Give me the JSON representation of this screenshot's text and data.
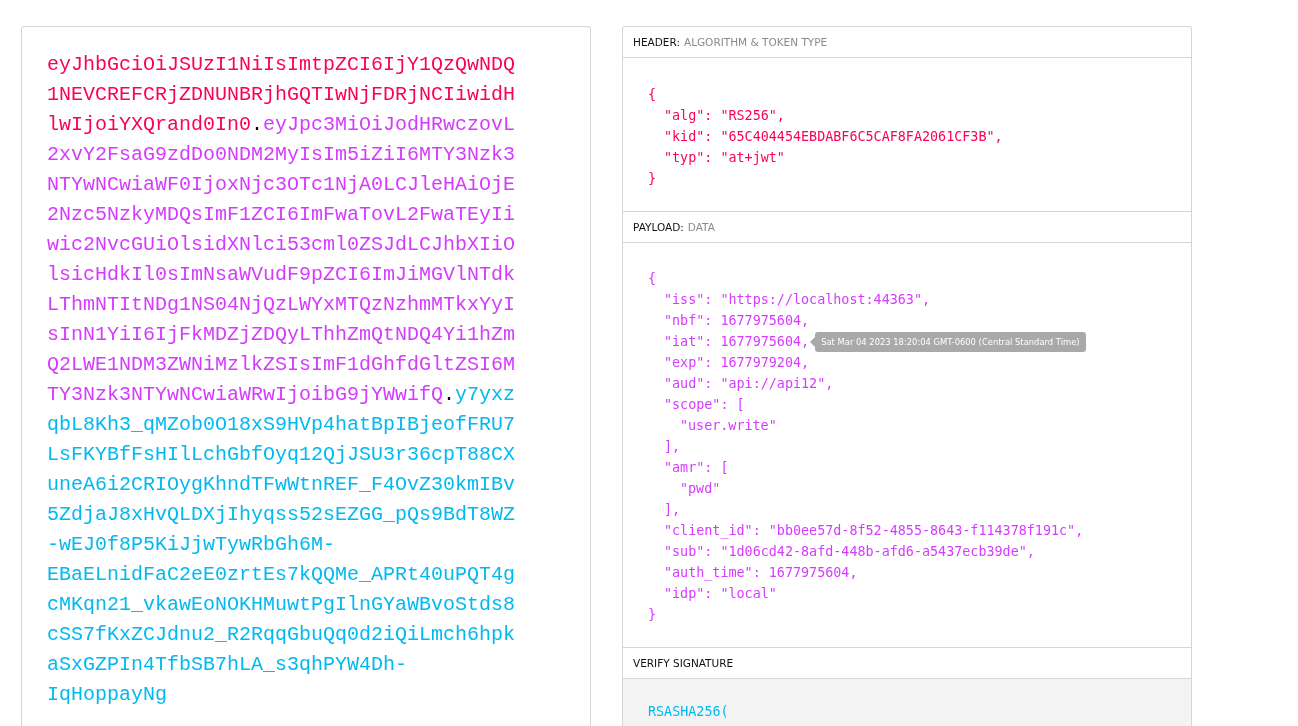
{
  "encoded_token": {
    "parts": [
      {
        "kind": "header",
        "text": "eyJhbGciOiJSUzI1NiIsImtpZCI6IjY1QzQwNDQ1NEVCREFCRjZDNUNBRjhGQTIwNjFDRjNCIiwidHlwIjoiYXQrand0In0"
      },
      {
        "kind": "dot",
        "text": "."
      },
      {
        "kind": "payload",
        "text": "eyJpc3MiOiJodHRwczovL2xvY2FsaG9zdDo0NDM2MyIsIm5iZiI6MTY3Nzk3NTYwNCwiaWF0IjoxNjc3OTc1NjA0LCJleHAiOjE2Nzc5NzkyMDQsImF1ZCI6ImFwaTovL2FwaTEyIiwic2NvcGUiOlsidXNlci53cml0ZSJdLCJhbXIiOlsicHdkIl0sImNsaWVudF9pZCI6ImJiMGVlNTdkLThmNTItNDg1NS04NjQzLWYxMTQzNzhmMTkxYyIsInN1YiI6IjFkMDZjZDQyLThhZmQtNDQ4Yi1hZmQ2LWE1NDM3ZWNiMzlkZSIsImF1dGhfdGltZSI6MTY3Nzk3NTYwNCwiaWRwIjoibG9jYWwifQ"
      },
      {
        "kind": "dot",
        "text": "."
      },
      {
        "kind": "signature",
        "text": "y7yxzqbL8Kh3_qMZob0O18xS9HVp4hatBpIBjeofFRU7LsFKYBfFsHIlLchGbfOyq12QjJSU3r36cpT88CXuneA6i2CRIOygKhndTFwWtnREF_F4OvZ30kmIBv5ZdjaJ8xHvQLDXjIhyqss52sEZGG_pQs9BdT8WZ-wEJ0f8P5KiJjwTywRbGh6M-EBaELnidFaC2eE0zrtEs7kQQMe_APRt40uPQT4gcMKqn21_vkawEoNOKHMuwtPgIlnGYaWBvoStds8cSS7fKxZCJdnu2_R2RqqGbuQq0d2iQiLmch6hpkaSxGZPIn4TfbSB7hLA_s3qhPYW4Dh-IqHoppayNg"
      }
    ]
  },
  "sections": [
    {
      "kind": "header",
      "title": "HEADER:",
      "subtitle": "ALGORITHM & TOKEN TYPE",
      "lines": [
        {
          "text": "{",
          "children": [
            {
              "text": "\"alg\": \"RS256\","
            },
            {
              "text": "\"kid\": \"65C404454EBDABF6C5CAF8FA2061CF3B\","
            },
            {
              "text": "\"typ\": \"at+jwt\""
            }
          ]
        },
        {
          "text": "}"
        }
      ]
    },
    {
      "kind": "payload",
      "title": "PAYLOAD:",
      "subtitle": "DATA",
      "lines": [
        {
          "text": "{",
          "children": [
            {
              "text": "\"iss\": \"https://localhost:44363\","
            },
            {
              "text": "\"nbf\": 1677975604,"
            },
            {
              "text": "\"iat\": 1677975604,",
              "tooltip": "Sat Mar 04 2023 18:20:04 GMT-0600 (Central Standard Time)"
            },
            {
              "text": "\"exp\": 1677979204,"
            },
            {
              "text": "\"aud\": \"api://api12\","
            },
            {
              "text": "\"scope\": [",
              "children": [
                {
                  "text": "\"user.write\""
                }
              ]
            },
            {
              "text": "],"
            },
            {
              "text": "\"amr\": [",
              "children": [
                {
                  "text": "\"pwd\""
                }
              ]
            },
            {
              "text": "],"
            },
            {
              "text": "\"client_id\": \"bb0ee57d-8f52-4855-8643-f114378f191c\","
            },
            {
              "text": "\"sub\": \"1d06cd42-8afd-448b-afd6-a5437ecb39de\","
            },
            {
              "text": "\"auth_time\": 1677975604,"
            },
            {
              "text": "\"idp\": \"local\""
            }
          ]
        },
        {
          "text": "}"
        }
      ]
    },
    {
      "kind": "signature",
      "title": "VERIFY SIGNATURE",
      "lines": [
        {
          "text": "RSASHA256("
        }
      ]
    }
  ]
}
